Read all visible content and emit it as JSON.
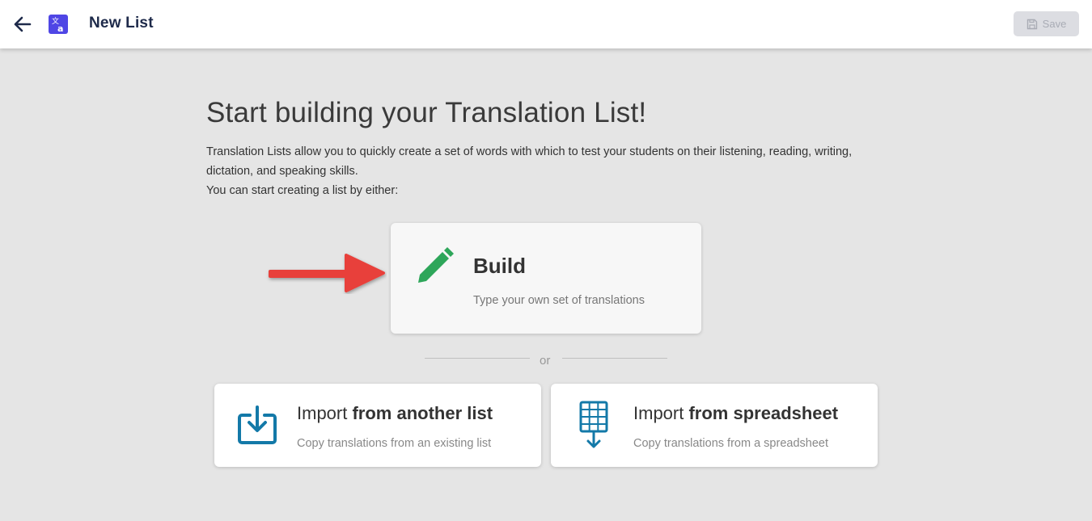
{
  "header": {
    "title": "New List",
    "save_label": "Save"
  },
  "intro": {
    "heading": "Start building your Translation List!",
    "description_line1": "Translation Lists allow you to quickly create a set of words with which to test your students on their listening, reading, writing, dictation, and speaking skills.",
    "description_line2": "You can start creating a list by either:"
  },
  "build": {
    "title": "Build",
    "subtitle": "Type your own set of translations"
  },
  "separator": "or",
  "import_list": {
    "prefix": "Import",
    "emphasis": "from another list",
    "subtitle": "Copy translations from an existing list"
  },
  "import_sheet": {
    "prefix": "Import",
    "emphasis": "from spreadsheet",
    "subtitle": "Copy translations from a spreadsheet"
  },
  "colors": {
    "accent": "#4f46e5",
    "build_icon": "#2ea65a",
    "import_icon": "#1379a8",
    "arrow": "#e53935"
  },
  "icons": [
    "back-arrow-icon",
    "translate-icon",
    "save-icon",
    "pencil-icon",
    "import-tray-icon",
    "spreadsheet-icon",
    "pointer-arrow-icon"
  ]
}
